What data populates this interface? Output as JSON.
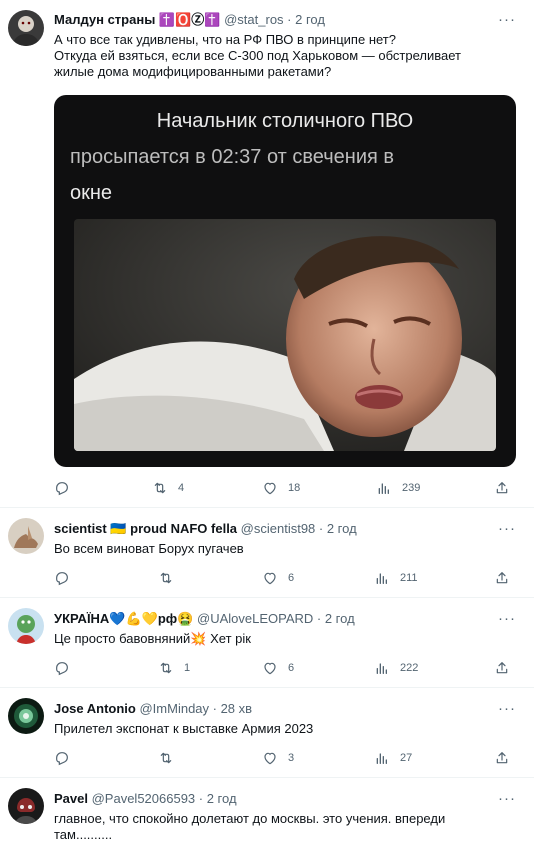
{
  "tweets": [
    {
      "name": "Малдун страны ✝️🅾️Ⓩ✝️",
      "handle": "@stat_ros · 2 год",
      "text1": "А что все так удивлены, что на РФ ПВО в принципе нет?",
      "text2": "Откуда ей взяться, если все С-300 под Харьковом — обстреливает",
      "text3": "жилые дома модифицированными ракетами?",
      "meme_line1": "Начальник столичного ПВО",
      "meme_line2": "просыпается в 02:37 от свечения в",
      "meme_line3": "окне",
      "retweets": "4",
      "likes": "18",
      "views": "239"
    },
    {
      "name": "scientist 🇺🇦 proud NAFO fella",
      "handle": "@scientist98 · 2 год",
      "text1": "Во всем виноват Борух пугачев",
      "retweets": "",
      "likes": "6",
      "views": "211"
    },
    {
      "name": "УКРАЇНА💙💪💛рф🤮",
      "handle": "@UAloveLEOPARD · 2 год",
      "text1": "Це просто бавовняний💥 Хет рік",
      "retweets": "1",
      "likes": "6",
      "views": "222"
    },
    {
      "name": "Jose Antonio",
      "handle": "@ImMinday · 28 хв",
      "text1": "Прилетел экспонат к выставке Армия 2023",
      "retweets": "",
      "likes": "3",
      "views": "27"
    },
    {
      "name": "Pavel",
      "handle": "@Pavel52066593 · 2 год",
      "text1": "главное, что спокойно долетают до москвы. это учения. впереди",
      "text2": "там.........."
    }
  ],
  "more_glyph": "···",
  "colors": {
    "muted": "#536471",
    "border": "#eff3f4",
    "text": "#0f1419"
  }
}
